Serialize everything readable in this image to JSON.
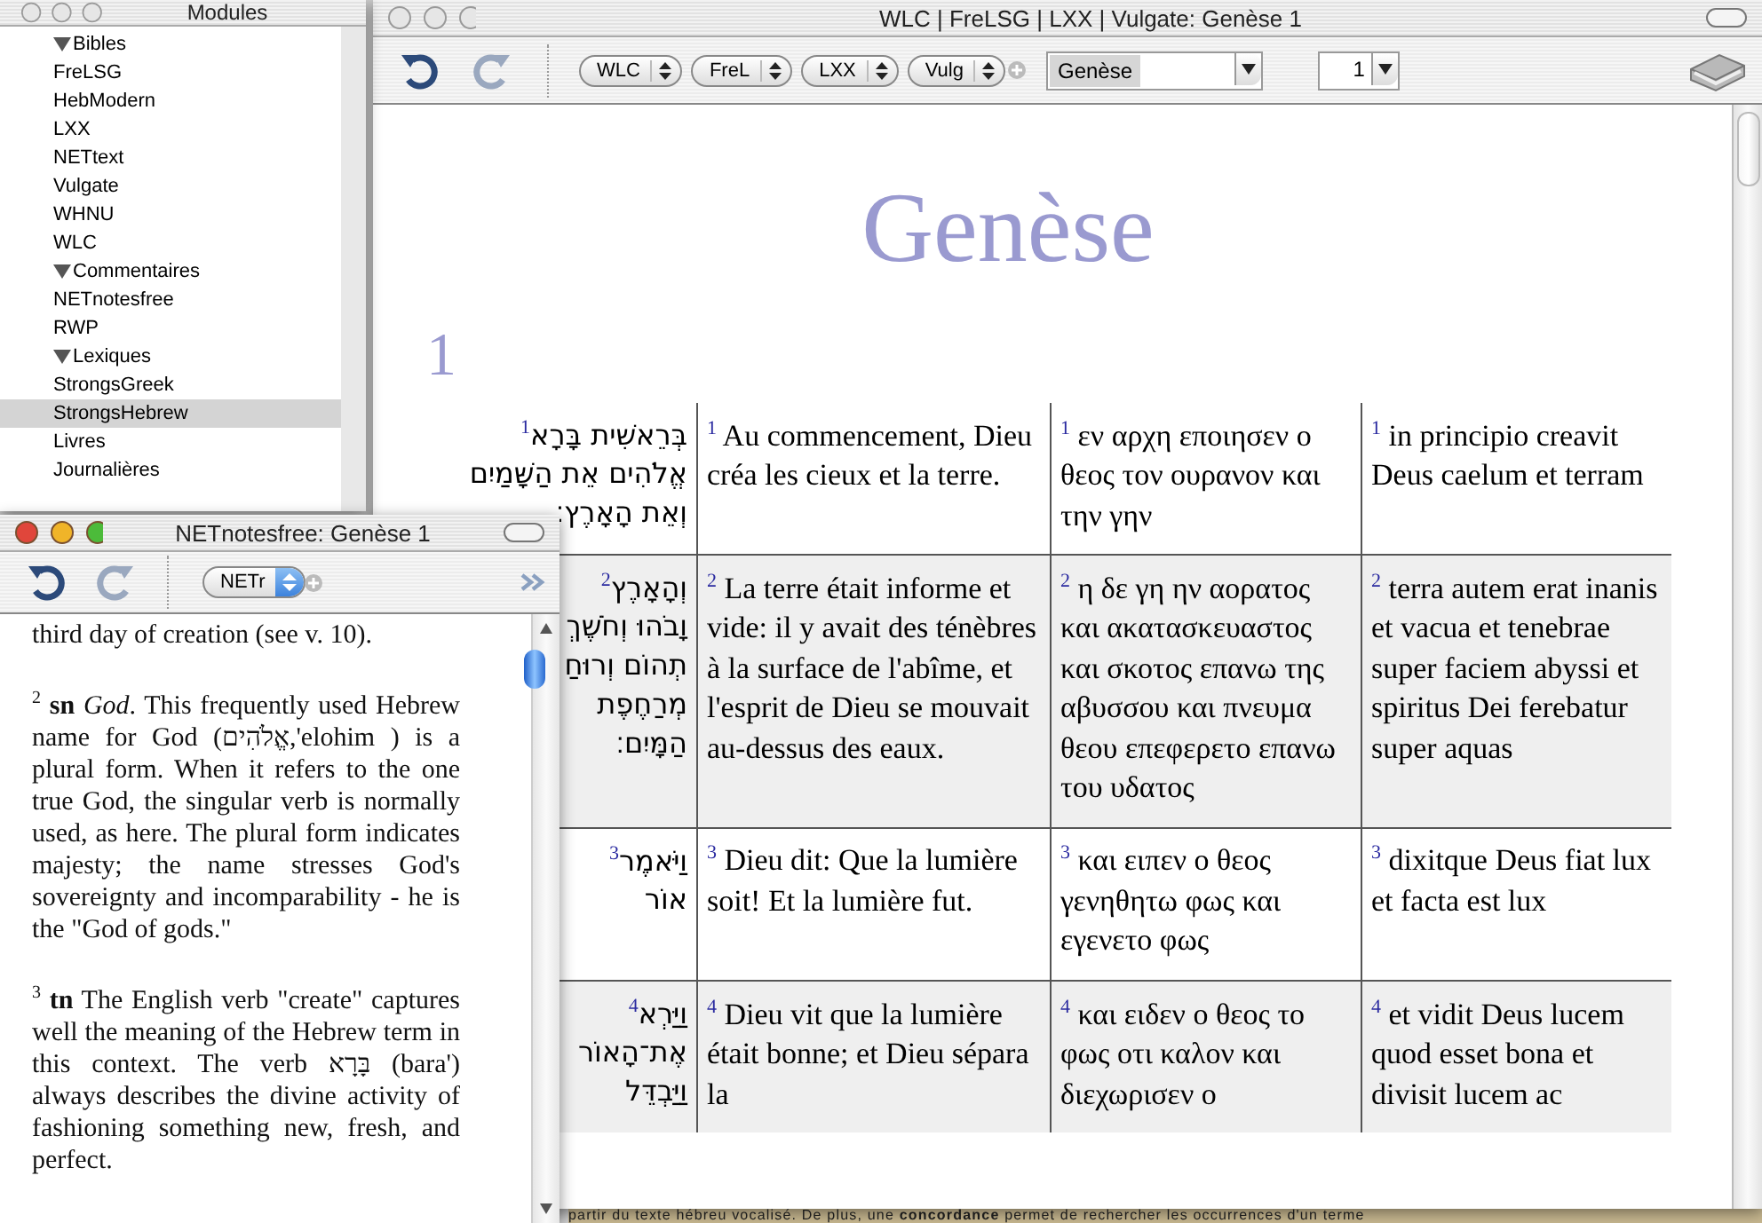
{
  "main_window": {
    "title": "WLC | FreLSG | LXX | Vulgate: Genèse 1",
    "module_selectors": [
      "WLC",
      "FreL",
      "LXX",
      "Vulg"
    ],
    "book": "Genèse",
    "chapter": "1",
    "book_heading": "Genèse",
    "chapter_heading": "1",
    "verses": [
      {
        "cells": [
          {
            "number": "1",
            "lines": [
              "בְּרֵאשִׁית בָּרָא",
              "אֱלֹהִים אֵת הַשָּׁמַיִם",
              "וְאֵת הָאָרֶץ׃"
            ]
          },
          {
            "number": "1",
            "text": "Au commencement, Dieu créa les cieux et la terre."
          },
          {
            "number": "1",
            "text": "εν αρχη εποιησεν ο θεος τον ουρανον και την γην"
          },
          {
            "number": "1",
            "text": "in principio creavit Deus caelum et terram"
          }
        ]
      },
      {
        "cells": [
          {
            "number": "2",
            "lines": [
              "וְהָאָרֶץ",
              "וָבֹהוּ וְחֹשֶׁךְ",
              "תְהוֹם וְרוּחַ",
              "מְרַחֶפֶת",
              "הַמָּיִם׃"
            ]
          },
          {
            "number": "2",
            "text": "La terre était informe et vide: il y avait des ténèbres à la surface de l'abîme, et l'esprit de Dieu se mouvait au-dessus des eaux."
          },
          {
            "number": "2",
            "text": "η δε γη ην αορατος και ακατασκευαστος και σκοτος επανω της αβυσσου και πνευμα θεου επεφερετο επανω του υδατος"
          },
          {
            "number": "2",
            "text": "terra autem erat inanis et vacua et tenebrae super faciem abyssi et spiritus Dei ferebatur super aquas"
          }
        ]
      },
      {
        "cells": [
          {
            "number": "3",
            "lines": [
              "וַיֹּאמֶר",
              "אוֹר"
            ]
          },
          {
            "number": "3",
            "text": "Dieu dit: Que la lumière soit! Et la lumière fut."
          },
          {
            "number": "3",
            "text": "και ειπεν ο θεος γενηθητω φως και εγενετο φως"
          },
          {
            "number": "3",
            "text": "dixitque Deus fiat lux et facta est lux"
          }
        ]
      },
      {
        "cells": [
          {
            "number": "4",
            "lines": [
              "וַיַּרְא",
              "אֶת־הָאוֹר",
              "וַיַּבְדֵּל"
            ]
          },
          {
            "number": "4",
            "text": "Dieu vit que la lumière était bonne; et Dieu sépara la"
          },
          {
            "number": "4",
            "text": "και ειδεν ο θεος το φως οτι καλον και διεχωρισεν ο"
          },
          {
            "number": "4",
            "text": "et vidit Deus lucem quod esset bona et divisit lucem ac"
          }
        ]
      }
    ]
  },
  "modules_window": {
    "title": "Modules",
    "tree": [
      {
        "label": "Bibles",
        "expanded": true,
        "selected": false,
        "children": [
          {
            "label": "FreLSG",
            "selected": false
          },
          {
            "label": "HebModern",
            "selected": false
          },
          {
            "label": "LXX",
            "selected": false
          },
          {
            "label": "NETtext",
            "selected": false
          },
          {
            "label": "Vulgate",
            "selected": false
          },
          {
            "label": "WHNU",
            "selected": false
          },
          {
            "label": "WLC",
            "selected": false
          }
        ]
      },
      {
        "label": "Commentaires",
        "expanded": true,
        "selected": false,
        "children": [
          {
            "label": "NETnotesfree",
            "selected": false
          },
          {
            "label": "RWP",
            "selected": false
          }
        ]
      },
      {
        "label": "Lexiques",
        "expanded": true,
        "selected": false,
        "children": [
          {
            "label": "StrongsGreek",
            "selected": false
          },
          {
            "label": "StrongsHebrew",
            "selected": true
          }
        ]
      },
      {
        "label": "Livres",
        "selected": false
      },
      {
        "label": "Journalières",
        "selected": false
      }
    ]
  },
  "notes_window": {
    "title": "NETnotesfree: Genèse 1",
    "module_selector": "NETr",
    "notes": [
      {
        "text": "third day of creation (see v. 10)."
      },
      {
        "number": "2",
        "text": "**sn** *God*. This frequently used Hebrew name for God (אֱלֹהִים,'elohim ) is a plural form. When it refers to the one true God, the singular verb is normally used, as here. The plural form indicates majesty; the name stresses God's sovereignty and incomparability - he is the \"God of gods.\""
      },
      {
        "number": "3",
        "text": "**tn** The English verb \"create\" captures well the meaning of the Hebrew term in this context. The verb בָּרָא (bara') always describes the divine activity of fashioning something new, fresh, and perfect."
      }
    ]
  },
  "background_text": "partir du texte hébreu vocalisé. De plus, une **concordance** permet de rechercher les occurrences d'un terme"
}
